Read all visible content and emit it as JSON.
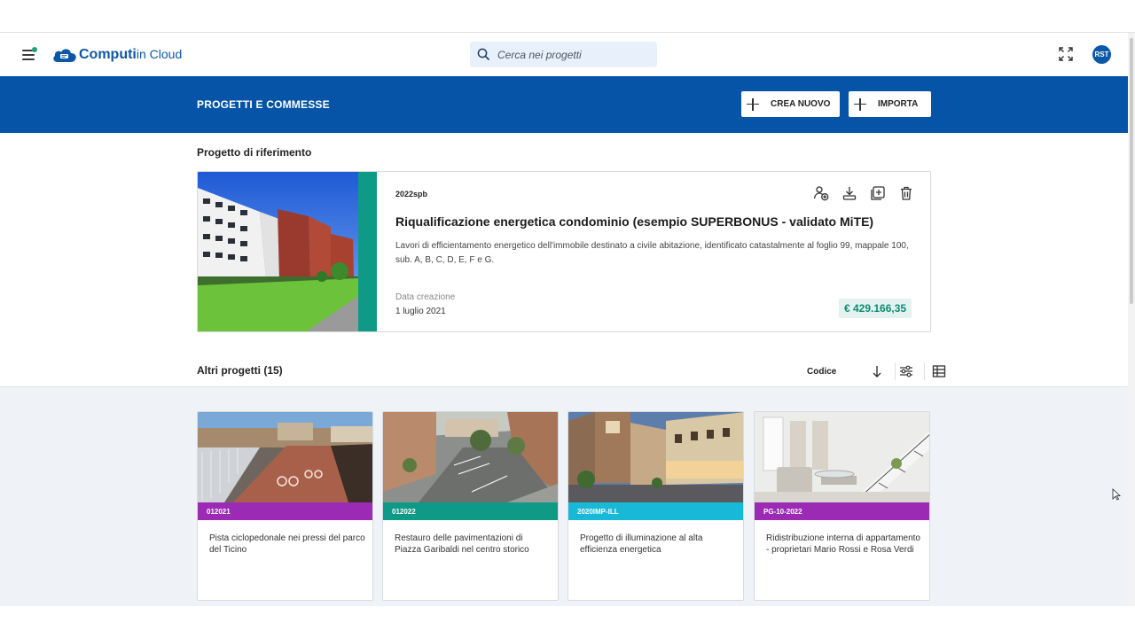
{
  "topbar": {
    "logo_bold": "Computi",
    "logo_thin": "in Cloud",
    "search_placeholder": "Cerca nei progetti",
    "avatar_initials": "RST"
  },
  "band": {
    "title": "PROGETTI E COMMESSE",
    "create_label": "CREA NUOVO",
    "import_label": "IMPORTA"
  },
  "featured": {
    "section_label": "Progetto di riferimento",
    "code": "2022spb",
    "title": "Riqualificazione energetica condominio (esempio SUPERBONUS - validato MiTE)",
    "description": "Lavori di efficientamento energetico dell'immobile destinato a civile abitazione, identificato catastalmente al foglio 99, mappale 100, sub. A, B, C, D, E, F e G.",
    "date_label": "Data creazione",
    "date": "1 luglio 2021",
    "price": "€ 429.166,35",
    "stripe_color": "#0e9a86"
  },
  "others": {
    "section_label": "Altri progetti (15)",
    "sort_label": "Codice"
  },
  "projects": [
    {
      "code": "012021",
      "description": "Pista ciclopedonale nei pressi del parco del Ticino",
      "color": "#9b2ab5"
    },
    {
      "code": "012022",
      "description": "Restauro delle pavimentazioni di Piazza Garibaldi nel centro storico",
      "color": "#0e9a86"
    },
    {
      "code": "2020IMP-ILL",
      "description": "Progetto di illuminazione al alta efficienza energetica",
      "color": "#17b9d6"
    },
    {
      "code": "PG-10-2022",
      "description": "Ridistribuzione interna di appartamento - proprietari Mario Rossi e Rosa Verdi",
      "color": "#9b2ab5"
    }
  ]
}
